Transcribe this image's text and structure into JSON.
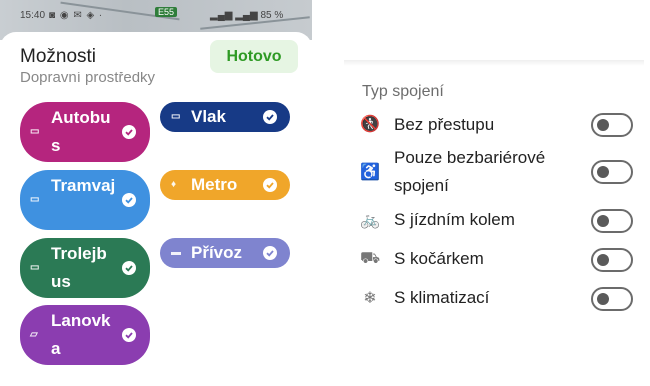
{
  "status": {
    "time": "15:40",
    "road_badge": "E55",
    "battery": "85 %"
  },
  "options": {
    "title": "Možnosti",
    "done_label": "Hotovo",
    "section_label": "Dopravní prostředky",
    "chips": [
      {
        "label": "Autobus",
        "icon": "bus-icon",
        "color": "#b5257e"
      },
      {
        "label": "Vlak",
        "icon": "train-icon",
        "color": "#173a86"
      },
      {
        "label": "Tramvaj",
        "icon": "tram-icon",
        "color": "#3f91e0"
      },
      {
        "label": "Metro",
        "icon": "metro-icon",
        "color": "#f0a62a"
      },
      {
        "label": "Trolejbus",
        "icon": "trolleybus-icon",
        "color": "#2b7a55"
      },
      {
        "label": "Přívoz",
        "icon": "ferry-icon",
        "color": "#7f84cf"
      },
      {
        "label": "Lanovka",
        "icon": "cable-car-icon",
        "color": "#8b3db0"
      }
    ]
  },
  "connection_type": {
    "heading": "Typ spojení",
    "rows": [
      {
        "label": "Bez přestupu",
        "icon": "no-transfer-icon",
        "enabled": false
      },
      {
        "label": "Pouze bezbariérové spojení",
        "icon": "wheelchair-icon",
        "enabled": false
      },
      {
        "label": "S jízdním kolem",
        "icon": "bicycle-icon",
        "enabled": false
      },
      {
        "label": "S kočárkem",
        "icon": "stroller-icon",
        "enabled": false
      },
      {
        "label": "S klimatizací",
        "icon": "snowflake-icon",
        "enabled": false
      }
    ]
  }
}
